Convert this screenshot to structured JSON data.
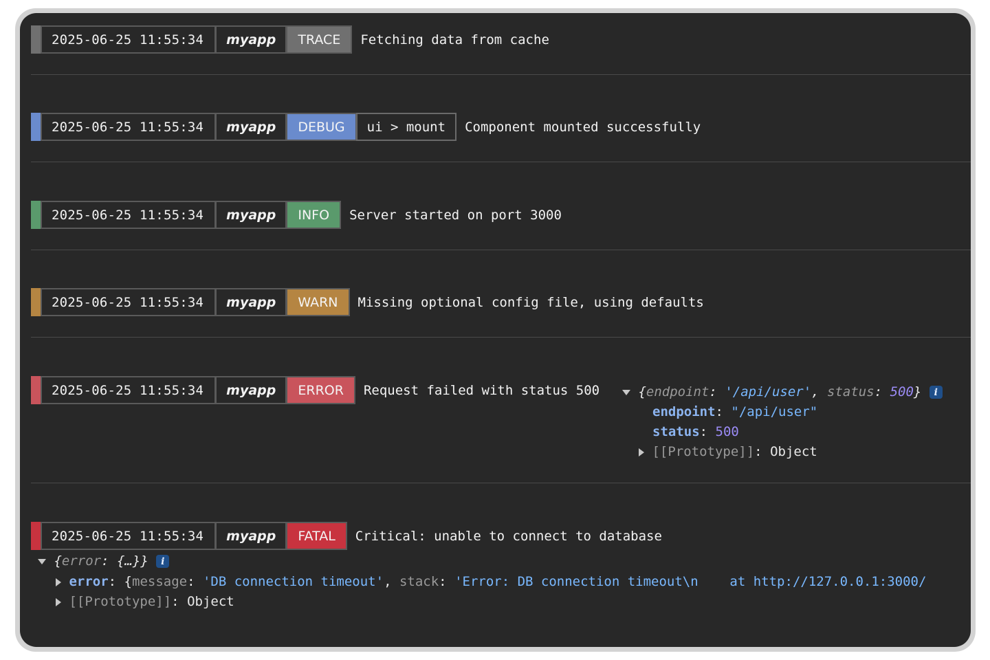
{
  "colors": {
    "trace": "#707070",
    "debug": "#6a8bcd",
    "info": "#5a9a6c",
    "warn": "#b58542",
    "error": "#c9545c",
    "fatal": "#c8333f"
  },
  "entries": [
    {
      "timestamp": "2025-06-25 11:55:34",
      "app": "myapp",
      "level": "TRACE",
      "message": "Fetching data from cache"
    },
    {
      "timestamp": "2025-06-25 11:55:34",
      "app": "myapp",
      "level": "DEBUG",
      "context": "ui > mount",
      "message": "Component mounted successfully"
    },
    {
      "timestamp": "2025-06-25 11:55:34",
      "app": "myapp",
      "level": "INFO",
      "message": "Server started on port 3000"
    },
    {
      "timestamp": "2025-06-25 11:55:34",
      "app": "myapp",
      "level": "WARN",
      "message": "Missing optional config file, using defaults"
    },
    {
      "timestamp": "2025-06-25 11:55:34",
      "app": "myapp",
      "level": "ERROR",
      "message": "Request failed with status 500"
    },
    {
      "timestamp": "2025-06-25 11:55:34",
      "app": "myapp",
      "level": "FATAL",
      "message": "Critical: unable to connect to database"
    }
  ],
  "error_object": {
    "summary_open": "{",
    "summary_endpoint_key": "endpoint",
    "summary_endpoint_val": "'/api/user'",
    "summary_status_key": "status",
    "summary_status_val": "500",
    "summary_close": "}",
    "endpoint_key": "endpoint",
    "endpoint_val": "\"/api/user\"",
    "status_key": "status",
    "status_val": "500",
    "proto_key": "[[Prototype]]",
    "proto_val": "Object"
  },
  "fatal_object": {
    "summary_open": "{",
    "summary_key": "error",
    "summary_val": "{…}",
    "summary_close": "}",
    "error_key": "error",
    "error_open": "{",
    "message_key": "message",
    "message_val": "'DB connection timeout'",
    "stack_key": "stack",
    "stack_val": "'Error: DB connection timeout\\n    at http://127.0.0.1:3000/",
    "proto_key": "[[Prototype]]",
    "proto_val": "Object"
  },
  "info_icon": "i"
}
